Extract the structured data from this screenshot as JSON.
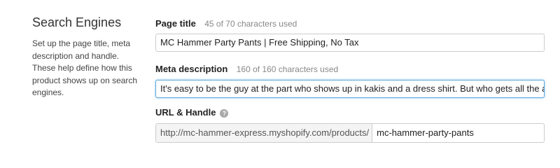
{
  "sidebar": {
    "title": "Search Engines",
    "description": "Set up the page title, meta description and handle. These help define how this product shows up on search engines."
  },
  "page_title": {
    "label": "Page title",
    "hint": "45 of 70 characters used",
    "value": "MC Hammer Party Pants | Free Shipping, No Tax"
  },
  "meta_description": {
    "label": "Meta description",
    "hint": "160 of 160 characters used",
    "value": "It's easy to be the guy at the part who shows up in kakis and a dress shirt.  But who gets all the a"
  },
  "url_handle": {
    "label": "URL & Handle",
    "help_icon": "question-circle-icon",
    "prefix": "http://mc-hammer-express.myshopify.com/products/",
    "handle": "mc-hammer-party-pants"
  },
  "colors": {
    "focus_border": "#5fa8d8",
    "input_border": "#cccccc",
    "hint_text": "#888888"
  }
}
